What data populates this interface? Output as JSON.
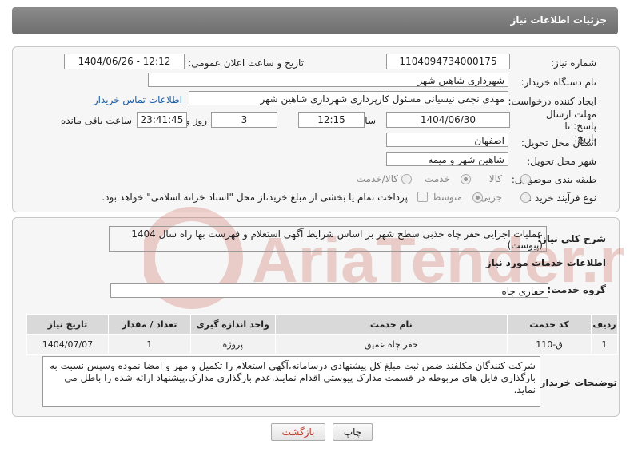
{
  "header": {
    "title": "جزئیات اطلاعات نیاز"
  },
  "fields": {
    "need_number_label": "شماره نیاز:",
    "need_number": "1104094734000175",
    "announce_label": "تاریخ و ساعت اعلان عمومی:",
    "announce_value": "1404/06/26 - 12:12",
    "buyer_org_label": "نام دستگاه خریدار:",
    "buyer_org": "شهرداری شاهین شهر",
    "creator_label": "ایجاد کننده درخواست:",
    "creator": "مهدی نجفی نیسیانی مسئول کارپردازی شهرداری شاهین شهر",
    "contact_link": "اطلاعات تماس خریدار",
    "deadline_label": "مهلت ارسال پاسخ: تا تاریخ:",
    "deadline_date": "1404/06/30",
    "time_label": "ساعت",
    "deadline_time": "12:15",
    "days_count": "3",
    "days_label": "روز و",
    "remaining_time": "23:41:45",
    "remaining_label": "ساعت باقی مانده",
    "province_label": "استان محل تحویل:",
    "province": "اصفهان",
    "city_label": "شهر محل تحویل:",
    "city": "شاهین شهر و میمه",
    "category_label": "طبقه بندی موضوعی:",
    "category_options": [
      "کالا",
      "خدمت",
      "کالا/خدمت"
    ],
    "process_label": "نوع فرآیند خرید :",
    "process_options": [
      "جزیی",
      "متوسط"
    ],
    "payment_note": "پرداخت تمام یا بخشی از مبلغ خرید،از محل \"اسناد خزانه اسلامی\" خواهد بود."
  },
  "summary": {
    "label": "شرح کلی نیاز:",
    "text": "عملیات اجرایی حفر چاه جذبی سطح شهر بر اساس شرایط آگهی استعلام و فهرست بها راه سال 1404 (پیوست)"
  },
  "services": {
    "section_title": "اطلاعات خدمات مورد نیاز",
    "group_label": "گروه خدمت:",
    "group_value": "حفاری چاه",
    "columns": [
      "ردیف",
      "کد خدمت",
      "نام خدمت",
      "واحد اندازه گیری",
      "تعداد / مقدار",
      "تاریخ نیاز"
    ],
    "rows": [
      [
        "1",
        "ق-110",
        "حفر چاه عمیق",
        "پروژه",
        "1",
        "1404/07/07"
      ]
    ]
  },
  "buyer_notes": {
    "label": "توضیحات خریدار:",
    "text": "شرکت کنندگان مکلفند ضمن ثبت مبلغ کل پیشنهادی درسامانه،آگهی استعلام را  تکمیل و مهر و امضا نموده وسپس نسبت به بارگذاری فایل های مربوطه در قسمت مدارک پیوستی اقدام نمایند.عدم بارگذاری مدارک،پیشنهاد ارائه شده را باطل می نماید."
  },
  "buttons": {
    "print": "چاپ",
    "back": "بازگشت"
  },
  "colors": {
    "header_bg": "#7a7a7a",
    "link": "#1a5ea8",
    "back_text": "#c0392b"
  }
}
